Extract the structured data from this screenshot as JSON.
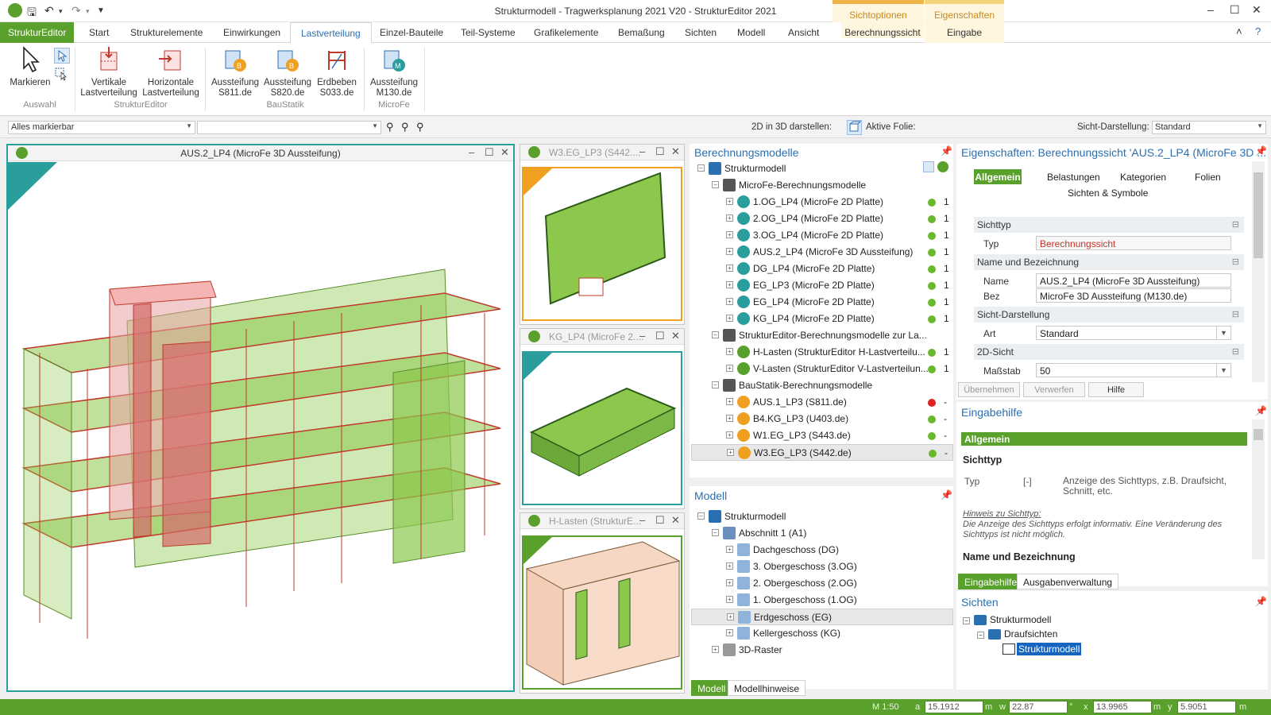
{
  "titlebar": {
    "title": "Strukturmodell - Tragwerksplanung 2021 V20 - StrukturEditor 2021",
    "ctx1_header": "Sichtoptionen",
    "ctx1_tab": "Berechnungssicht",
    "ctx2_header": "Eigenschaften",
    "ctx2_tab": "Eingabe",
    "minimize": "–",
    "maximize": "☐",
    "close": "✕",
    "collapse": "˄",
    "help": "?"
  },
  "tabs": {
    "file": "StrukturEditor",
    "items": [
      "Start",
      "Strukturelemente",
      "Einwirkungen",
      "Lastverteilung",
      "Einzel-Bauteile",
      "Teil-Systeme",
      "Grafikelemente",
      "Bemaßung",
      "Sichten",
      "Modell",
      "Ansicht"
    ],
    "active": "Lastverteilung"
  },
  "ribbon": {
    "buttons": [
      {
        "label1": "Markieren",
        "label2": ""
      },
      {
        "label1": "Vertikale",
        "label2": "Lastverteilung"
      },
      {
        "label1": "Horizontale",
        "label2": "Lastverteilung"
      },
      {
        "label1": "Aussteifung",
        "label2": "S811.de"
      },
      {
        "label1": "Aussteifung",
        "label2": "S820.de"
      },
      {
        "label1": "Erdbeben",
        "label2": "S033.de"
      },
      {
        "label1": "Aussteifung",
        "label2": "M130.de"
      }
    ],
    "groups": [
      "Auswahl",
      "StrukturEditor",
      "BauStatik",
      "MicroFe"
    ]
  },
  "toolbar": {
    "select_mode": "Alles markierbar",
    "second_combo": "",
    "label_2d3d": "2D in 3D darstellen:",
    "label_folie": "Aktive Folie:",
    "label_sicht": "Sicht-Darstellung:",
    "sicht_value": "Standard"
  },
  "views": {
    "main_title": "AUS.2_LP4 (MicroFe 3D Aussteifung)",
    "v1": "W3.EG_LP3 (S442....",
    "v2": "KG_LP4 (MicroFe 2....",
    "v3": "H-Lasten (StrukturE..."
  },
  "berechnungsmodelle": {
    "title": "Berechnungsmodelle",
    "root": "Strukturmodell",
    "group1": "MicroFe-Berechnungsmodelle",
    "microfe": [
      {
        "label": "1.OG_LP4 (MicroFe 2D Platte)",
        "count": "1"
      },
      {
        "label": "2.OG_LP4 (MicroFe 2D Platte)",
        "count": "1"
      },
      {
        "label": "3.OG_LP4 (MicroFe 2D Platte)",
        "count": "1"
      },
      {
        "label": "AUS.2_LP4 (MicroFe 3D Aussteifung)",
        "count": "1"
      },
      {
        "label": "DG_LP4 (MicroFe 2D Platte)",
        "count": "1"
      },
      {
        "label": "EG_LP3 (MicroFe 2D Platte)",
        "count": "1"
      },
      {
        "label": "EG_LP4 (MicroFe 2D Platte)",
        "count": "1"
      },
      {
        "label": "KG_LP4 (MicroFe 2D Platte)",
        "count": "1"
      }
    ],
    "group2": "StrukturEditor-Berechnungsmodelle zur La...",
    "struktur": [
      {
        "label": "H-Lasten (StrukturEditor H-Lastverteilu...",
        "count": "1"
      },
      {
        "label": "V-Lasten (StrukturEditor V-Lastverteilun...",
        "count": "1"
      }
    ],
    "group3": "BauStatik-Berechnungsmodelle",
    "baustatik": [
      {
        "label": "AUS.1_LP3 (S811.de)",
        "count": "-"
      },
      {
        "label": "B4.KG_LP3 (U403.de)",
        "count": "-"
      },
      {
        "label": "W1.EG_LP3 (S443.de)",
        "count": "-"
      },
      {
        "label": "W3.EG_LP3 (S442.de)",
        "count": "-"
      }
    ]
  },
  "modell": {
    "title": "Modell",
    "root": "Strukturmodell",
    "abschnitt": "Abschnitt 1 (A1)",
    "floors": [
      "Dachgeschoss (DG)",
      "3. Obergeschoss (3.OG)",
      "2. Obergeschoss (2.OG)",
      "1. Obergeschoss (1.OG)",
      "Erdgeschoss (EG)",
      "Kellergeschoss (KG)"
    ],
    "raster": "3D-Raster",
    "tab_modell": "Modell",
    "tab_hinweise": "Modellhinweise"
  },
  "properties": {
    "title": "Eigenschaften: Berechnungssicht 'AUS.2_LP4 (MicroFe 3D ...",
    "tabs": [
      "Allgemein",
      "Belastungen",
      "Kategorien",
      "Folien",
      "Sichten & Symbole"
    ],
    "sec_sichttyp": "Sichttyp",
    "typ_label": "Typ",
    "typ_value": "Berechnungssicht",
    "sec_name": "Name und Bezeichnung",
    "name_label": "Name",
    "name_value": "AUS.2_LP4 (MicroFe 3D Aussteifung)",
    "bez_label": "Bez",
    "bez_value": "MicroFe 3D Aussteifung (M130.de)",
    "sec_sicht": "Sicht-Darstellung",
    "art_label": "Art",
    "art_value": "Standard",
    "sec_2d": "2D-Sicht",
    "massstab_label": "Maßstab",
    "massstab_value": "50",
    "btn_ok": "Übernehmen",
    "btn_cancel": "Verwerfen",
    "btn_help": "Hilfe"
  },
  "eingabehilfe": {
    "title": "Eingabehilfe",
    "bar": "Allgemein",
    "h1": "Sichttyp",
    "typ": "Typ",
    "unit": "[-]",
    "desc": "Anzeige des Sichttyps, z.B. Draufsicht, Schnitt, etc.",
    "hint_title": "Hinweis zu Sichttyp:",
    "hint_text": "Die Anzeige des Sichttyps erfolgt informativ. Eine Veränderung des Sichttyps ist nicht möglich.",
    "h2": "Name und Bezeichnung",
    "tab1": "Eingabehilfe",
    "tab2": "Ausgabenverwaltung"
  },
  "sichten": {
    "title": "Sichten",
    "root": "Strukturmodell",
    "child": "Draufsichten",
    "leaf": "Strukturmodell"
  },
  "status": {
    "scale": "M 1:50",
    "a_label": "a",
    "a_value": "15.1912",
    "m": "m",
    "w_label": "w",
    "w_value": "22.87",
    "deg": "°",
    "x_label": "x",
    "x_value": "13.9965",
    "y_label": "y",
    "y_value": "5.9051"
  },
  "colors": {
    "accent": "#5aa02c",
    "blue": "#2b6fb3",
    "teal": "#2a9d9d",
    "orange": "#f0a020"
  }
}
